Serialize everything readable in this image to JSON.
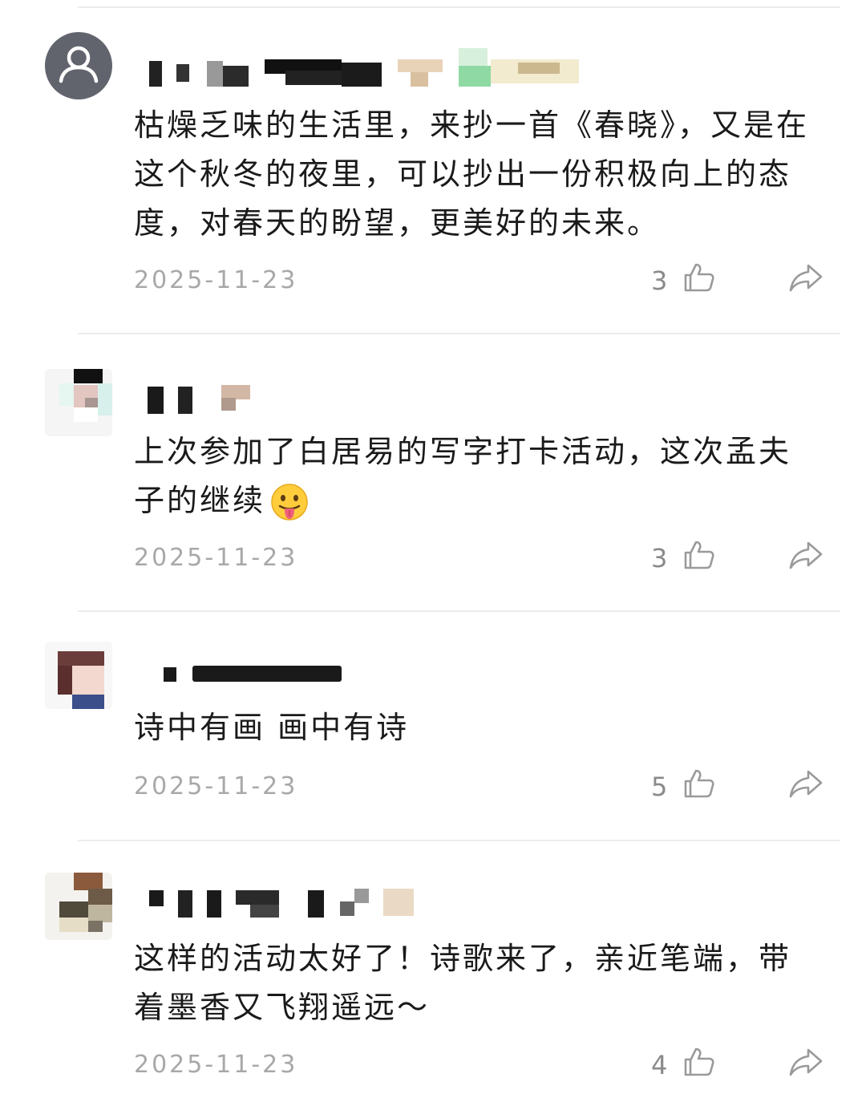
{
  "comments": [
    {
      "text": "枯燥乏味的生活里，来抄一首《春晓》，又是在这个秋冬的夜里，可以抄出一份积极向上的态度，对春天的盼望，更美好的未来。",
      "date": "2025-11-23",
      "likes": "3",
      "avatar_icon": "default-user-icon"
    },
    {
      "text": "上次参加了白居易的写字打卡活动，这次孟夫子的继续",
      "emoji": "😛",
      "date": "2025-11-23",
      "likes": "3"
    },
    {
      "text": "诗中有画 画中有诗",
      "date": "2025-11-23",
      "likes": "5"
    },
    {
      "text": "这样的活动太好了！诗歌来了，亲近笔端，带着墨香又飞翔遥远～",
      "date": "2025-11-23",
      "likes": "4"
    }
  ],
  "icons": {
    "like": "thumbs-up-icon",
    "share": "share-arrow-icon"
  },
  "colors": {
    "text": "#1a1a1a",
    "meta": "#a8a8a8",
    "likes": "#8a8a8a",
    "divider": "#ececec",
    "default_avatar": "#62646d"
  }
}
